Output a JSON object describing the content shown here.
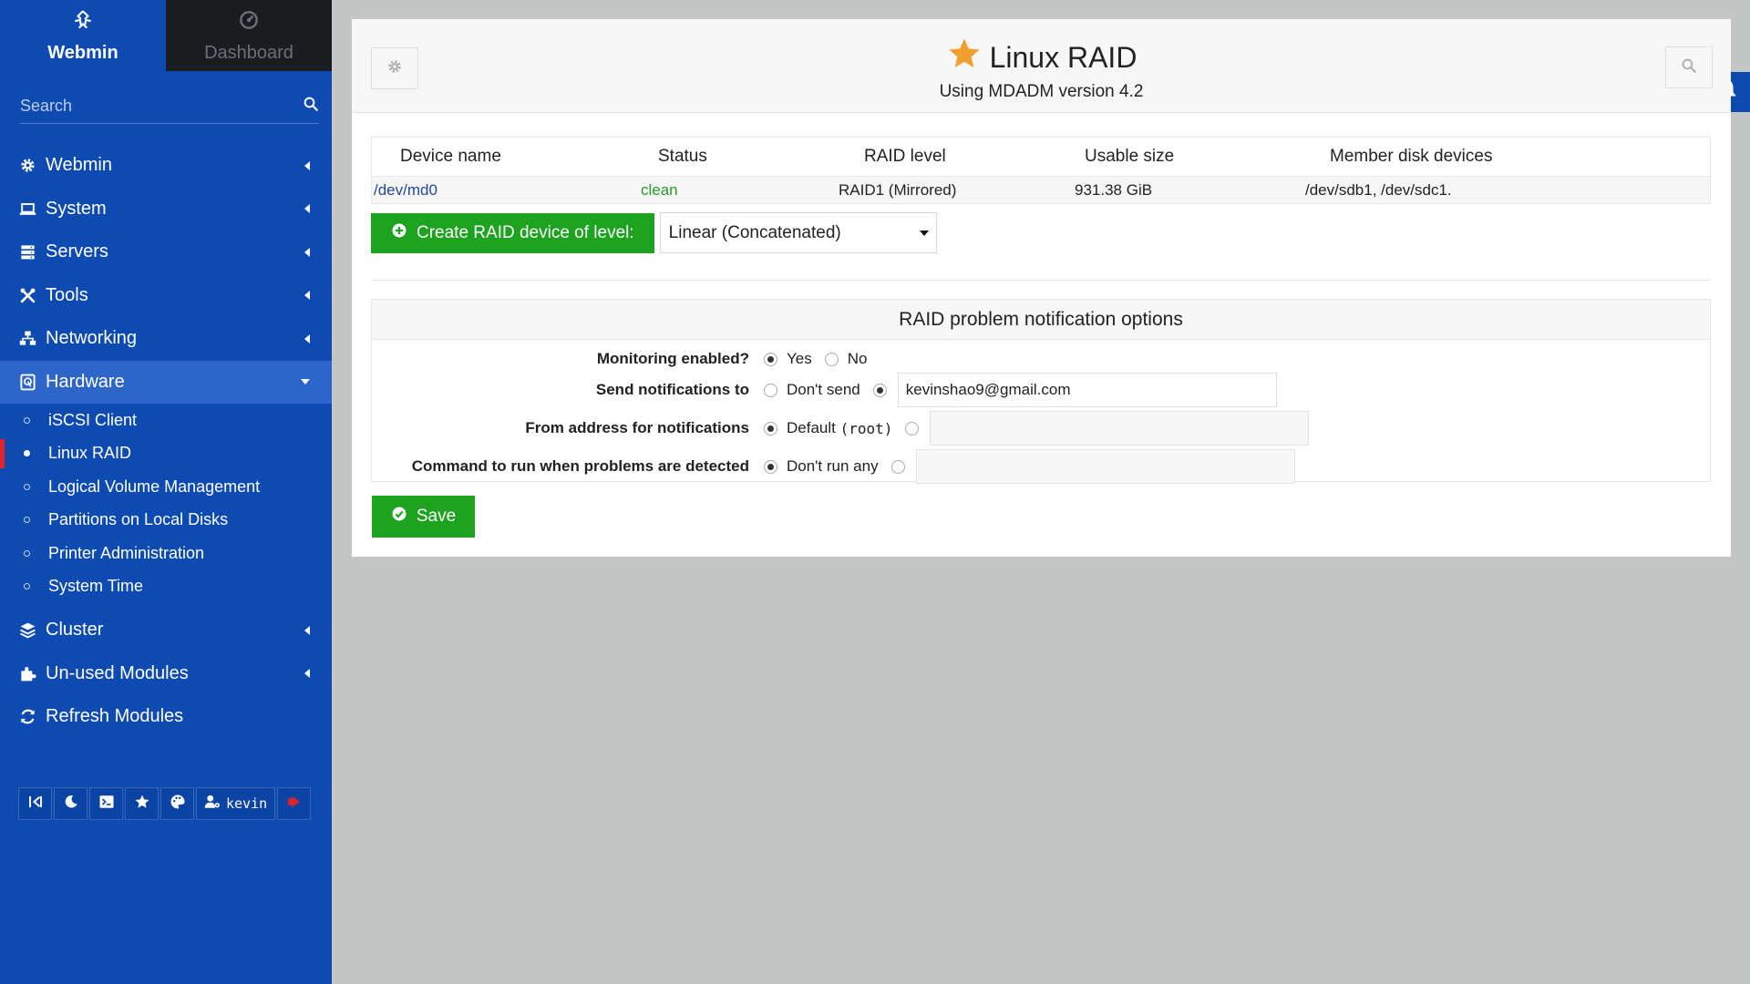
{
  "sidebar": {
    "tabs": [
      {
        "label": "Webmin",
        "icon": "webmin-logo-icon"
      },
      {
        "label": "Dashboard",
        "icon": "dashboard-icon"
      }
    ],
    "search_placeholder": "Search",
    "menu": [
      {
        "label": "Webmin",
        "icon": "gear-icon"
      },
      {
        "label": "System",
        "icon": "laptop-icon"
      },
      {
        "label": "Servers",
        "icon": "server-icon"
      },
      {
        "label": "Tools",
        "icon": "tools-icon"
      },
      {
        "label": "Networking",
        "icon": "network-icon"
      },
      {
        "label": "Hardware",
        "icon": "hard-drive-icon"
      }
    ],
    "hardware_items": [
      "iSCSI Client",
      "Linux RAID",
      "Logical Volume Management",
      "Partitions on Local Disks",
      "Printer Administration",
      "System Time"
    ],
    "menu_after": [
      {
        "label": "Cluster",
        "icon": "layers-icon"
      },
      {
        "label": "Un-used Modules",
        "icon": "puzzle-icon"
      },
      {
        "label": "Refresh Modules",
        "icon": "refresh-icon"
      }
    ],
    "current_item": "Linux RAID",
    "username": "kevin"
  },
  "header": {
    "title": "Linux RAID",
    "subtitle": "Using MDADM version 4.2"
  },
  "raid_table": {
    "columns": [
      "Device name",
      "Status",
      "RAID level",
      "Usable size",
      "Member disk devices"
    ],
    "rows": [
      {
        "device": "/dev/md0",
        "status": "clean",
        "level": "RAID1 (Mirrored)",
        "size": "931.38 GiB",
        "members": "/dev/sdb1, /dev/sdc1."
      }
    ]
  },
  "create": {
    "button_label": "Create RAID device of level:",
    "selected_level": "Linear (Concatenated)"
  },
  "notifications": {
    "title": "RAID problem notification options",
    "monitoring_label": "Monitoring enabled?",
    "monitoring_yes": "Yes",
    "monitoring_no": "No",
    "send_label": "Send notifications to",
    "send_dont": "Don't send",
    "send_email": "kevinshao9@gmail.com",
    "from_label": "From address for notifications",
    "from_default": "Default",
    "from_default_code": "(root)",
    "command_label": "Command to run when problems are detected",
    "command_dont": "Don't run any"
  },
  "save_label": "Save",
  "colors": {
    "sidebar": "#0d4bb3",
    "sidebar_active": "#2d65c8",
    "green": "#1ea321",
    "star": "#f0a030",
    "status_clean": "#2a9b2a",
    "current_marker": "#e0242b"
  }
}
